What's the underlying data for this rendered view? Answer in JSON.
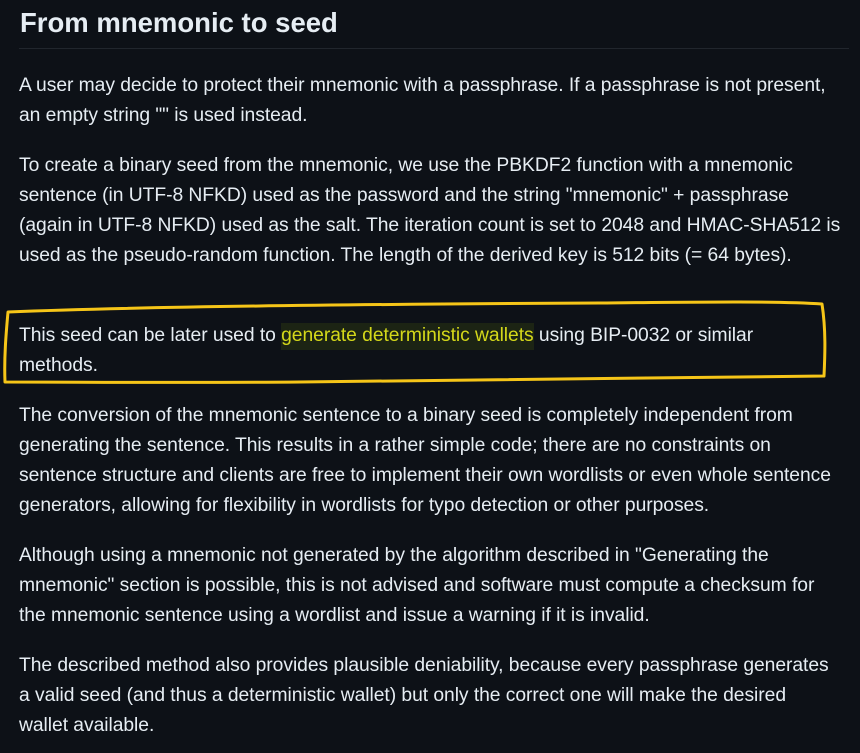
{
  "section": {
    "heading": "From mnemonic to seed"
  },
  "paragraphs": {
    "p1": "A user may decide to protect their mnemonic with a passphrase. If a passphrase is not present, an empty string \"\" is used instead.",
    "p2": "To create a binary seed from the mnemonic, we use the PBKDF2 function with a mnemonic sentence (in UTF-8 NFKD) used as the password and the string \"mnemonic\" + passphrase (again in UTF-8 NFKD) used as the salt. The iteration count is set to 2048 and HMAC-SHA512 is used as the pseudo-random function. The length of the derived key is 512 bits (= 64 bytes).",
    "p3_before": "This seed can be later used to ",
    "p3_link": "generate deterministic wallets",
    "p3_after": " using BIP-0032 or similar methods.",
    "p4": "The conversion of the mnemonic sentence to a binary seed is completely independent from generating the sentence. This results in a rather simple code; there are no constraints on sentence structure and clients are free to implement their own wordlists or even whole sentence generators, allowing for flexibility in wordlists for typo detection or other purposes.",
    "p5": "Although using a mnemonic not generated by the algorithm described in \"Generating the mnemonic\" section is possible, this is not advised and software must compute a checksum for the mnemonic sentence using a wordlist and issue a warning if it is invalid.",
    "p6": "The described method also provides plausible deniability, because every passphrase generates a valid seed (and thus a deterministic wallet) but only the correct one will make the desired wallet available."
  },
  "colors": {
    "background": "#0d1117",
    "text": "#e6edf3",
    "link": "#d4d81a",
    "annotation": "#f5c518"
  }
}
